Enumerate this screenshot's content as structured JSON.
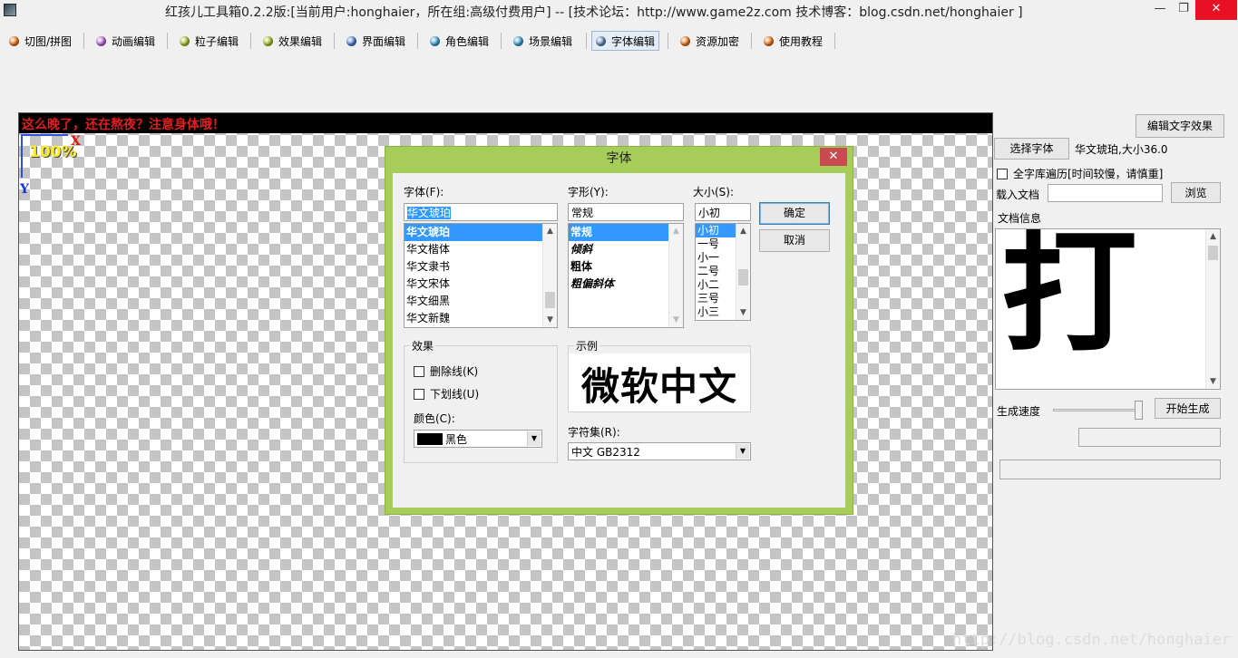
{
  "window": {
    "title": "红孩儿工具箱0.2.2版:[当前用户:honghaier，所在组:高级付费用户]  --  [技术论坛：http://www.game2z.com 技术博客：blog.csdn.net/honghaier ]",
    "min_glyph": "—",
    "max_glyph": "❐",
    "close_glyph": "✕"
  },
  "menu": [
    {
      "label": "切图/拼图",
      "color": "#e07018"
    },
    {
      "label": "动画编辑",
      "color": "#b060d0"
    },
    {
      "label": "粒子编辑",
      "color": "#a0b828"
    },
    {
      "label": "效果编辑",
      "color": "#a0b828"
    },
    {
      "label": "界面编辑",
      "color": "#4878c8"
    },
    {
      "label": "角色编辑",
      "color": "#3898c8"
    },
    {
      "label": "场景编辑",
      "color": "#3898c8"
    },
    {
      "label": "字体编辑",
      "color": "#6080b0"
    },
    {
      "label": "资源加密",
      "color": "#e07018"
    },
    {
      "label": "使用教程",
      "color": "#e07018"
    }
  ],
  "canvas": {
    "banner": "这么晚了，还在熬夜？注意身体哦！",
    "axis_x": "X",
    "axis_y": "Y",
    "zoom": "100%",
    "watermark": "http://blog.csdn.net/honghaier"
  },
  "font_dialog": {
    "title": "字体",
    "close": "✕",
    "font_label": "字体(F):",
    "font_value": "华文琥珀",
    "fonts": [
      "华文琥珀",
      "华文楷体",
      "华文隶书",
      "华文宋体",
      "华文细黑",
      "华文新魏"
    ],
    "style_label": "字形(Y):",
    "style_value": "常规",
    "styles": [
      "常规",
      "倾斜",
      "粗体",
      "粗偏斜体"
    ],
    "size_label": "大小(S):",
    "size_value": "小初",
    "sizes": [
      "小初",
      "一号",
      "小一",
      "二号",
      "小二",
      "三号",
      "小三"
    ],
    "ok": "确定",
    "cancel": "取消",
    "effects_title": "效果",
    "strikeout": "删除线(K)",
    "underline": "下划线(U)",
    "color_label": "颜色(C):",
    "color_value": "黑色",
    "sample_title": "示例",
    "sample_text": "微软中文",
    "charset_label": "字符集(R):",
    "charset_value": "中文 GB2312"
  },
  "right_panel": {
    "edit_effect_button": "编辑文字效果",
    "select_font_button": "选择字体",
    "font_info": "华文琥珀,大小36.0",
    "traverse_all_label": "全字库遍历[时间较慢，请慎重]",
    "load_doc_label": "载入文档",
    "browse_button": "浏览",
    "doc_info_label": "文档信息",
    "doc_glyph": "打",
    "speed_label": "生成速度",
    "start_button": "开始生成"
  }
}
